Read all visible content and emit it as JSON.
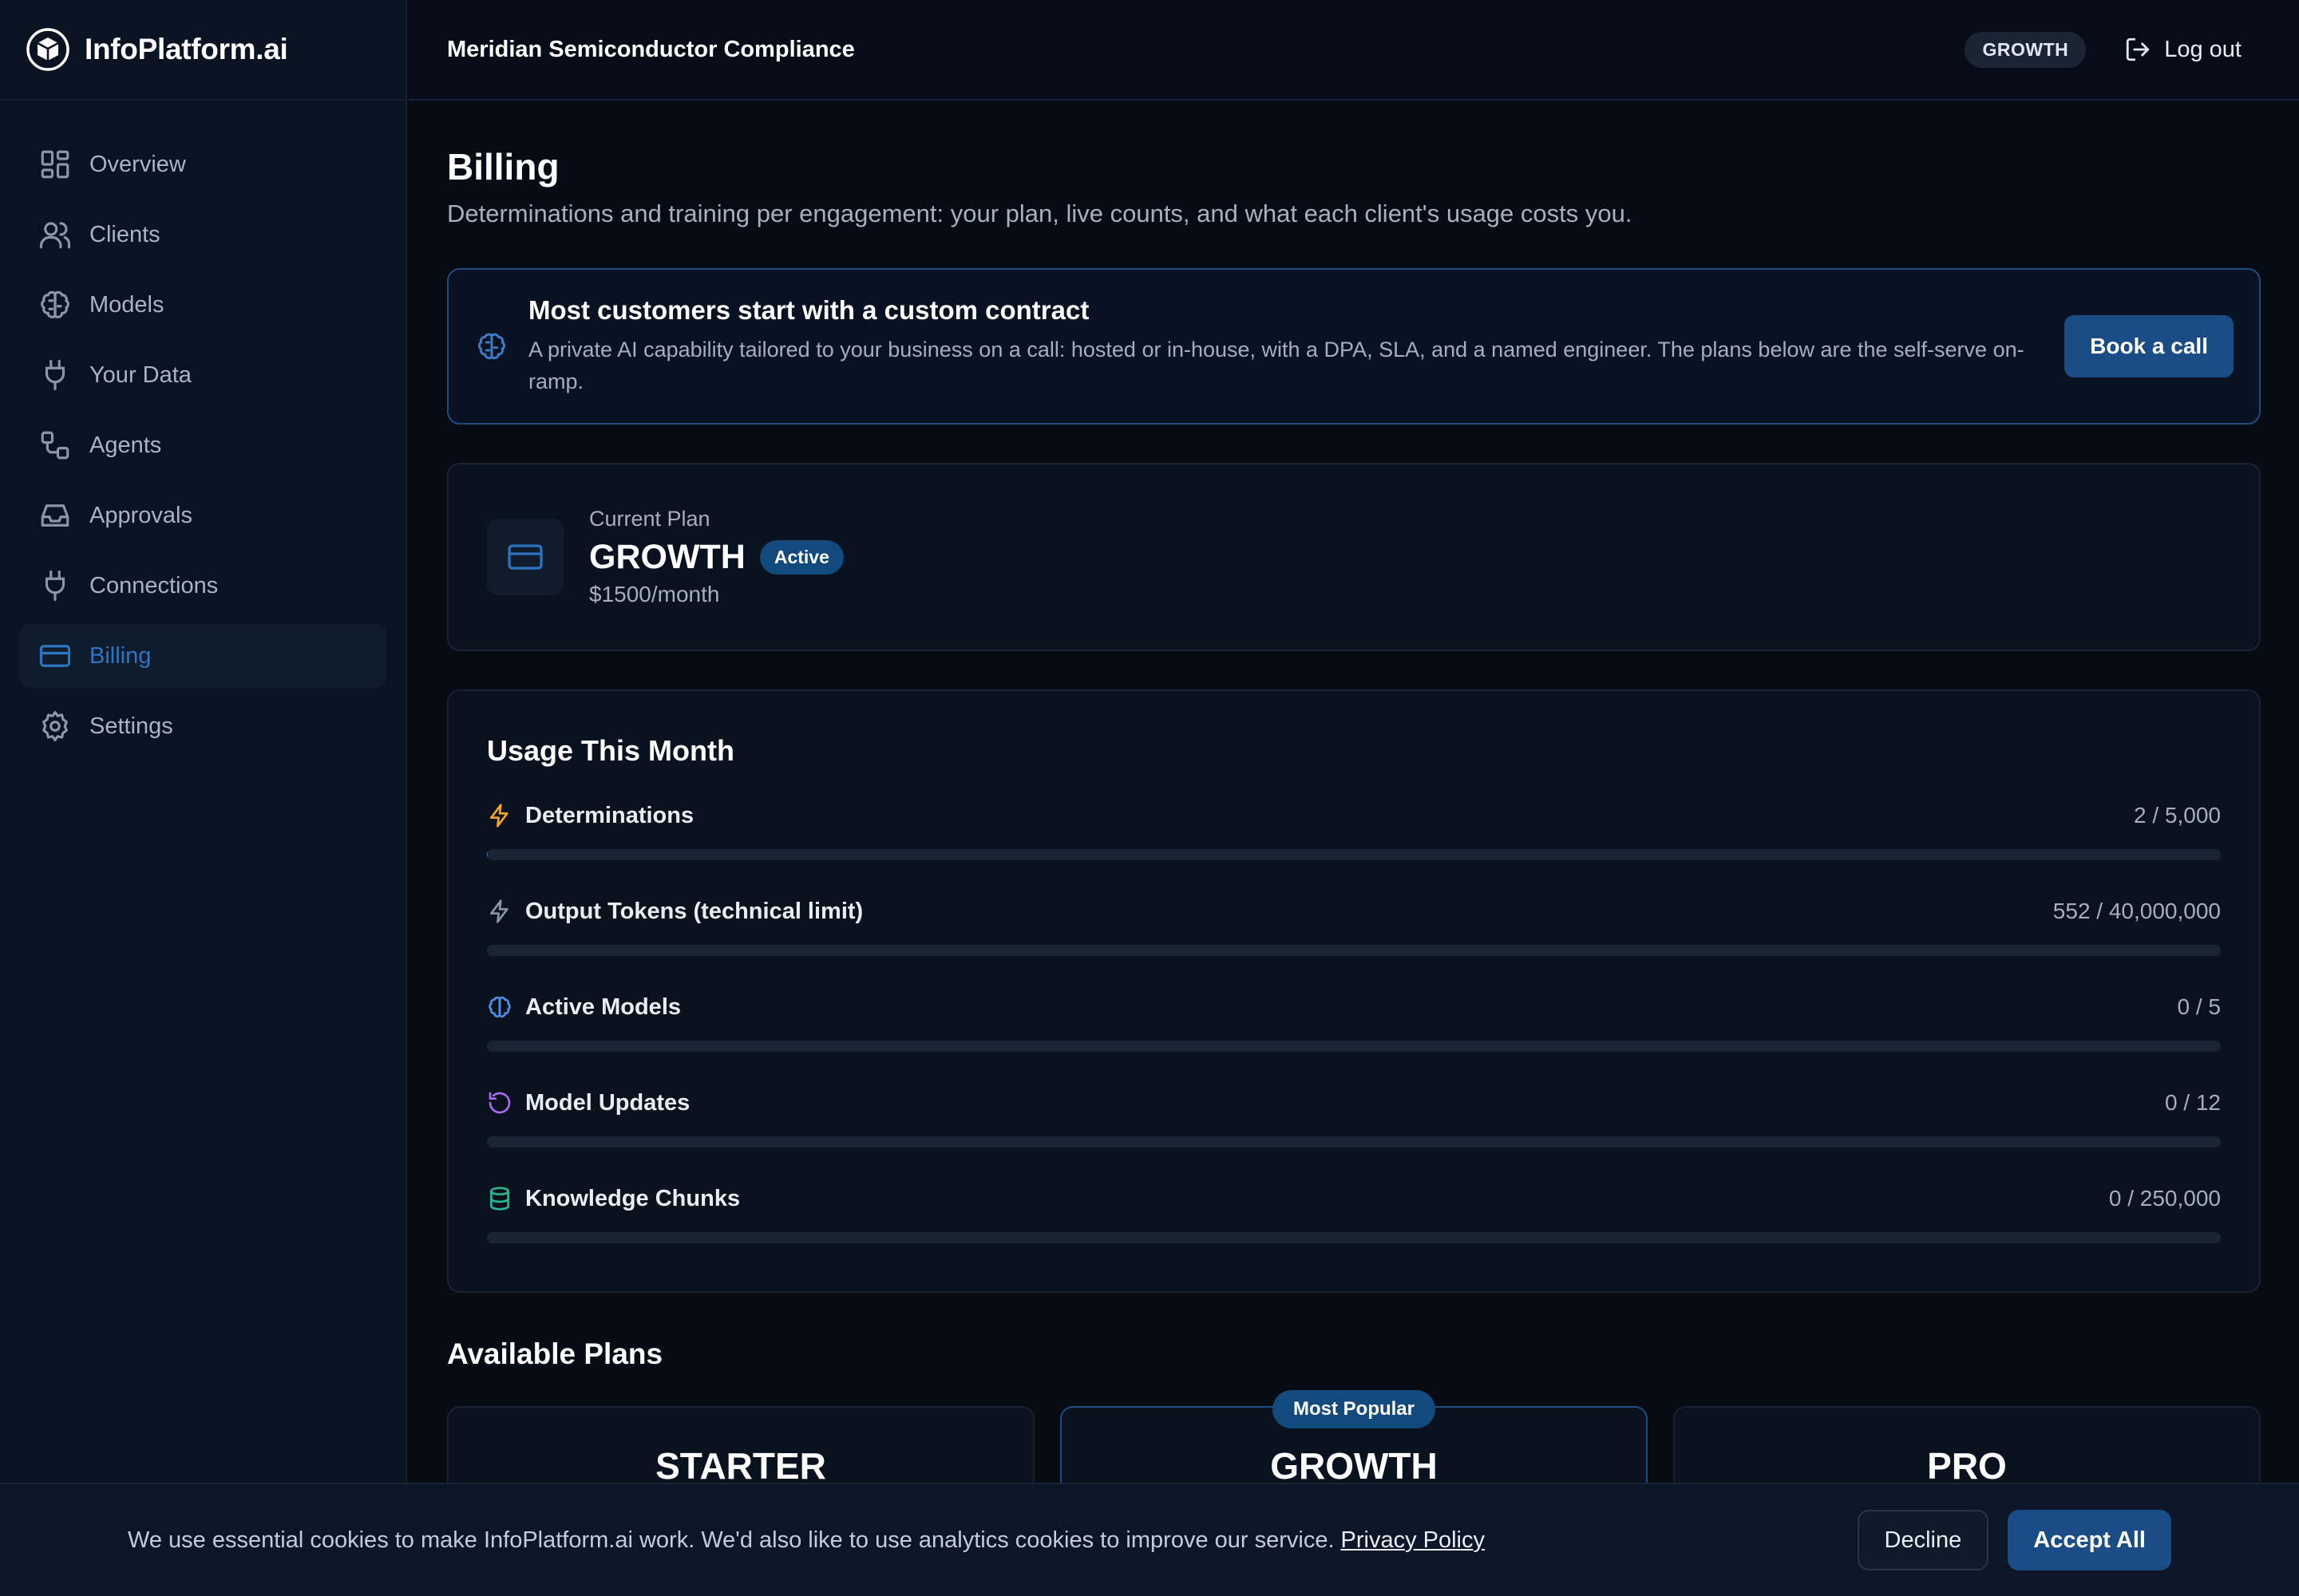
{
  "brand": {
    "name": "InfoPlatform.ai",
    "icon": "cube-logo-icon"
  },
  "sidebar": {
    "items": [
      {
        "label": "Overview",
        "icon": "grid-icon"
      },
      {
        "label": "Clients",
        "icon": "users-icon"
      },
      {
        "label": "Models",
        "icon": "brain-icon"
      },
      {
        "label": "Your Data",
        "icon": "plug-icon"
      },
      {
        "label": "Agents",
        "icon": "workflow-icon"
      },
      {
        "label": "Approvals",
        "icon": "inbox-icon"
      },
      {
        "label": "Connections",
        "icon": "plug-icon"
      },
      {
        "label": "Billing",
        "icon": "credit-card-icon",
        "active": true
      },
      {
        "label": "Settings",
        "icon": "gear-icon"
      }
    ]
  },
  "header": {
    "org_name": "Meridian Semiconductor Compliance",
    "plan_badge": "GROWTH",
    "logout_label": "Log out"
  },
  "page": {
    "title": "Billing",
    "subtitle": "Determinations and training per engagement: your plan, live counts, and what each client's usage costs you."
  },
  "cta": {
    "title": "Most customers start with a custom contract",
    "body": "A private AI capability tailored to your business on a call: hosted or in-house, with a DPA, SLA, and a named engineer. The plans below are the self-serve on-ramp.",
    "button": "Book a call"
  },
  "current_plan": {
    "label": "Current Plan",
    "name": "GROWTH",
    "status": "Active",
    "price": "$1500/month"
  },
  "usage": {
    "title": "Usage This Month",
    "rows": [
      {
        "label": "Determinations",
        "value": "2 / 5,000",
        "fraction": 0.0004,
        "icon": "bolt-icon",
        "icon_color": "#f5a524"
      },
      {
        "label": "Output Tokens (technical limit)",
        "value": "552 / 40,000,000",
        "fraction": 1.38e-05,
        "icon": "bolt-icon",
        "icon_color": "#8b97a8"
      },
      {
        "label": "Active Models",
        "value": "0 / 5",
        "fraction": 0,
        "icon": "brain-icon",
        "icon_color": "#4d8ee0"
      },
      {
        "label": "Model Updates",
        "value": "0 / 12",
        "fraction": 0,
        "icon": "refresh-icon",
        "icon_color": "#a66bf0"
      },
      {
        "label": "Knowledge Chunks",
        "value": "0 / 250,000",
        "fraction": 0,
        "icon": "database-icon",
        "icon_color": "#26b892"
      }
    ]
  },
  "plans": {
    "title": "Available Plans",
    "popular_badge": "Most Popular",
    "options": [
      {
        "name": "STARTER"
      },
      {
        "name": "GROWTH",
        "popular": true
      },
      {
        "name": "PRO"
      }
    ]
  },
  "cookie": {
    "text": "We use essential cookies to make InfoPlatform.ai work. We'd also like to use analytics cookies to improve our service.",
    "link": "Privacy Policy",
    "decline": "Decline",
    "accept": "Accept All"
  },
  "colors": {
    "accent": "#2f74c0",
    "button": "#1a4d85",
    "background": "#060b14",
    "sidebar": "#0a1322"
  }
}
